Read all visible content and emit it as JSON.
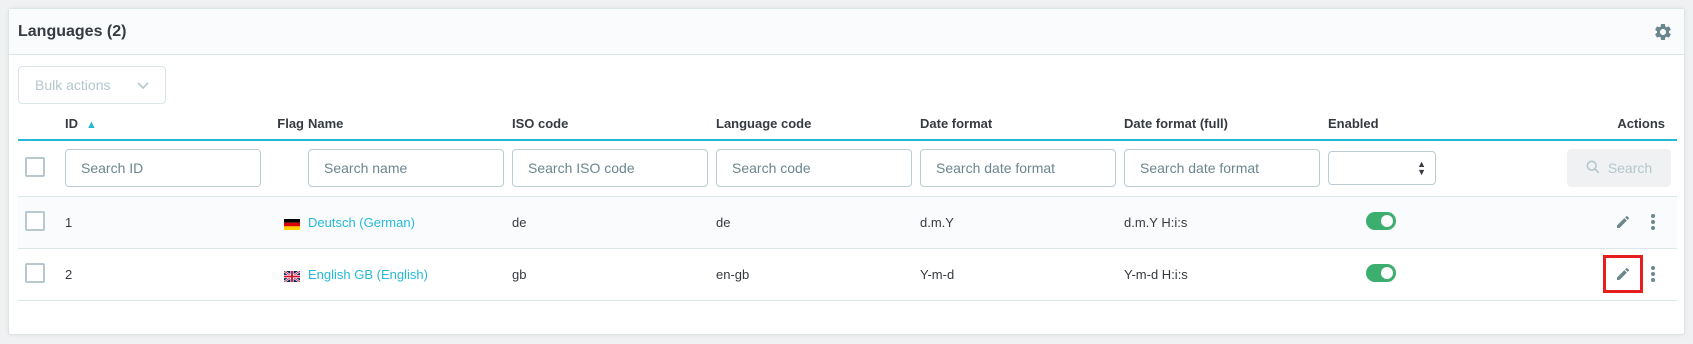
{
  "header": {
    "title": "Languages (2)"
  },
  "toolbar": {
    "bulk_actions_label": "Bulk actions"
  },
  "columns": {
    "id": "ID",
    "flag": "Flag",
    "name": "Name",
    "iso": "ISO code",
    "lang_code": "Language code",
    "date_format": "Date format",
    "date_format_full": "Date format (full)",
    "enabled": "Enabled",
    "actions": "Actions"
  },
  "filters": {
    "id_placeholder": "Search ID",
    "name_placeholder": "Search name",
    "iso_placeholder": "Search ISO code",
    "code_placeholder": "Search code",
    "date_placeholder": "Search date format",
    "date_full_placeholder": "Search date format",
    "search_button": "Search"
  },
  "rows": [
    {
      "id": "1",
      "flag": "de-flag",
      "name": "Deutsch (German)",
      "iso": "de",
      "lang_code": "de",
      "date_format": "d.m.Y",
      "date_format_full": "d.m.Y H:i:s",
      "enabled": true
    },
    {
      "id": "2",
      "flag": "gb-flag",
      "name": "English GB (English)",
      "iso": "gb",
      "lang_code": "en-gb",
      "date_format": "Y-m-d",
      "date_format_full": "Y-m-d H:i:s",
      "enabled": true
    }
  ],
  "colors": {
    "accent": "#25b9d7",
    "enabled_green": "#3cae6e",
    "highlight_red": "#e61e1e"
  }
}
